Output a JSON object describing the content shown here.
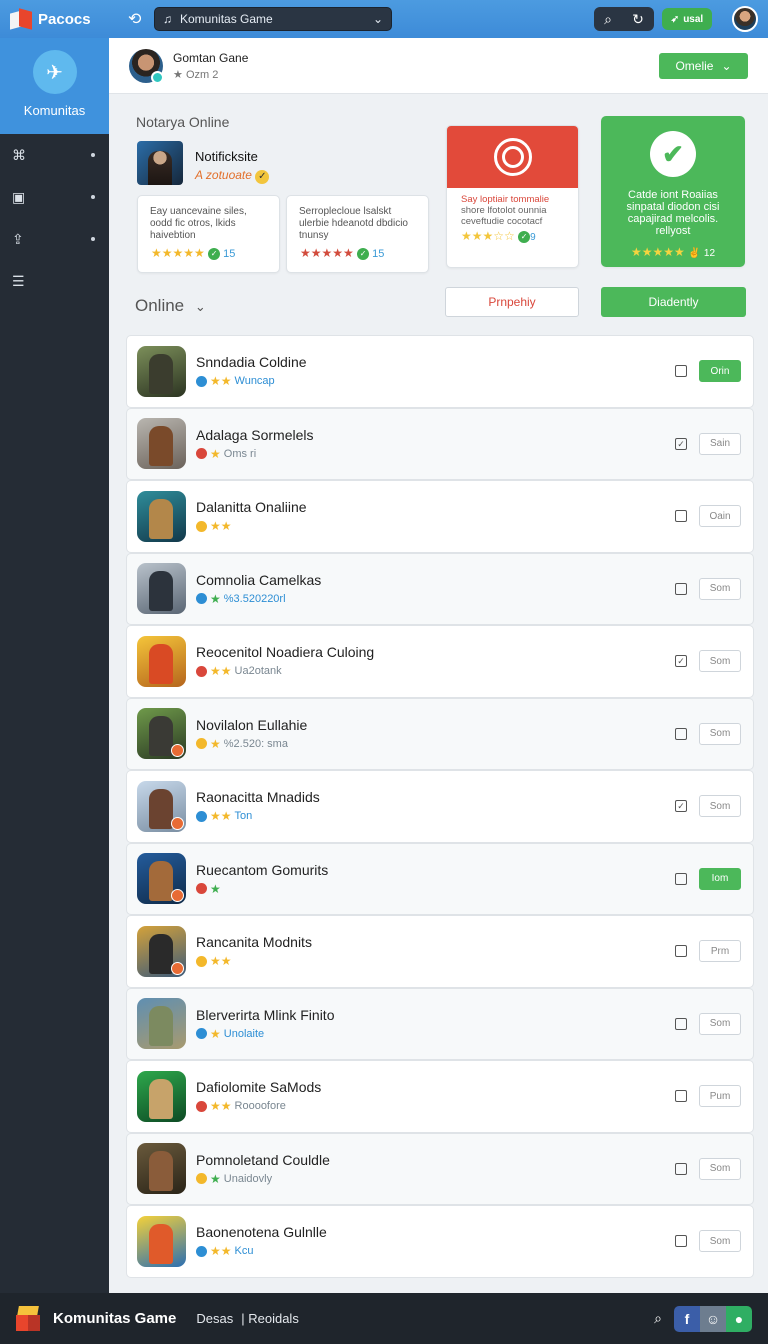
{
  "topbar": {
    "brand": "Pacocs",
    "search_value": "Komunitas Game",
    "pill_label": "usal"
  },
  "sidebar": {
    "title": "Komunitas",
    "items": [
      {
        "icon": "gamepad-icon"
      },
      {
        "icon": "bag-icon"
      },
      {
        "icon": "share-icon"
      },
      {
        "icon": "list-icon"
      }
    ]
  },
  "subheader": {
    "title": "Gomtan Gane",
    "meta": "Ozm",
    "meta_count": "2",
    "button": "Omelie"
  },
  "featured": {
    "section_title": "Notarya Online",
    "name": "Notificksite",
    "tag": "A zotuoate"
  },
  "cards": [
    {
      "text": "Eay uancevaine siles, oodd fic otros, lkids haivebtion",
      "count": "15"
    },
    {
      "text": "Serroplecloue lsalskt ulerbie hdeanotd dbdicio tnunsy",
      "count": "15"
    },
    {
      "headline": "Say loptiair tommalie",
      "text": "shore lfotolot ounnia ceveftudie cocotacf",
      "count": "9"
    },
    {
      "text": "Catde iont Roaiias sinpatal diodon cisi capajirad melcolis. rellyost",
      "count": "12"
    }
  ],
  "online": {
    "title": "Online",
    "button_outline": "Prnpehiy",
    "button_green": "Diadently"
  },
  "games": [
    {
      "name": "Snndadia Coldine",
      "sub": "Wuncap",
      "action": "Orin",
      "active": true,
      "checked": false
    },
    {
      "name": "Adalaga Sormelels",
      "sub": "Oms ri",
      "action": "Sain",
      "active": false,
      "checked": true
    },
    {
      "name": "Dalanitta Onaliine",
      "sub": "",
      "action": "Oain",
      "active": false,
      "checked": false
    },
    {
      "name": "Comnolia Camelkas",
      "sub": "%3.520220rl",
      "action": "Som",
      "active": false,
      "checked": false
    },
    {
      "name": "Reocenitol Noadiera Culoing",
      "sub": "Ua2otank",
      "action": "Som",
      "active": false,
      "checked": true
    },
    {
      "name": "Novilalon Eullahie",
      "sub": "%2.520: sma",
      "action": "Som",
      "active": false,
      "checked": false
    },
    {
      "name": "Raonacitta Mnadids",
      "sub": "Ton",
      "action": "Som",
      "active": false,
      "checked": true
    },
    {
      "name": "Ruecantom Gomurits",
      "sub": "",
      "action": "Iom",
      "active": true,
      "checked": false
    },
    {
      "name": "Rancanita Modnits",
      "sub": "",
      "action": "Prm",
      "active": false,
      "checked": false
    },
    {
      "name": "Blerverirta Mlink Finito",
      "sub": "Unolaite",
      "action": "Som",
      "active": false,
      "checked": false
    },
    {
      "name": "Dafiolomite SaMods",
      "sub": "Roooofore",
      "action": "Pum",
      "active": false,
      "checked": false
    },
    {
      "name": "Pomnoletand Couldle",
      "sub": "Unaidovly",
      "action": "Som",
      "active": false,
      "checked": false
    },
    {
      "name": "Baonenotena Gulnlle",
      "sub": "Kcu",
      "action": "Som",
      "active": false,
      "checked": false
    }
  ],
  "bottombar": {
    "title": "Komunitas Game",
    "link1": "Desas",
    "link2": "Reoidals"
  },
  "colors": {
    "accent_blue": "#3f92dd",
    "accent_green": "#4cb85a",
    "accent_red": "#e24a3a",
    "sidebar_bg": "#252c35"
  }
}
